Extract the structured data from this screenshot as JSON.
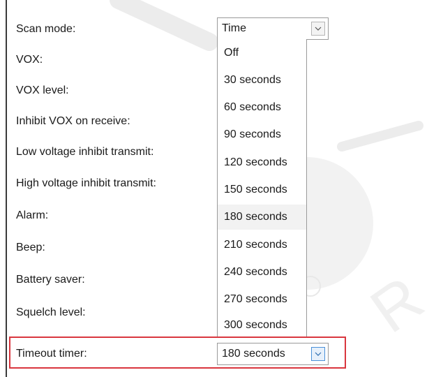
{
  "fields": {
    "scan_mode": {
      "label": "Scan mode:",
      "value": "Time"
    },
    "vox": {
      "label": "VOX:"
    },
    "vox_level": {
      "label": "VOX level:"
    },
    "inhibit_vox": {
      "label": "Inhibit VOX on receive:"
    },
    "low_voltage": {
      "label": "Low voltage inhibit transmit:"
    },
    "high_voltage": {
      "label": "High voltage inhibit transmit:"
    },
    "alarm": {
      "label": "Alarm:"
    },
    "beep": {
      "label": "Beep:"
    },
    "battery_saver": {
      "label": "Battery saver:"
    },
    "squelch_level": {
      "label": "Squelch level:"
    },
    "timeout_timer": {
      "label": "Timeout timer:",
      "value": "180 seconds"
    }
  },
  "dropdown": {
    "options": [
      "Off",
      "30 seconds",
      "60 seconds",
      "90 seconds",
      "120 seconds",
      "150 seconds",
      "180 seconds",
      "210 seconds",
      "240 seconds",
      "270 seconds",
      "300 seconds"
    ],
    "selected": "180 seconds"
  },
  "colors": {
    "highlight_box": "#d9363e",
    "active_chevron": "#4a90d9",
    "selected_option_bg": "#f2f2f2"
  }
}
